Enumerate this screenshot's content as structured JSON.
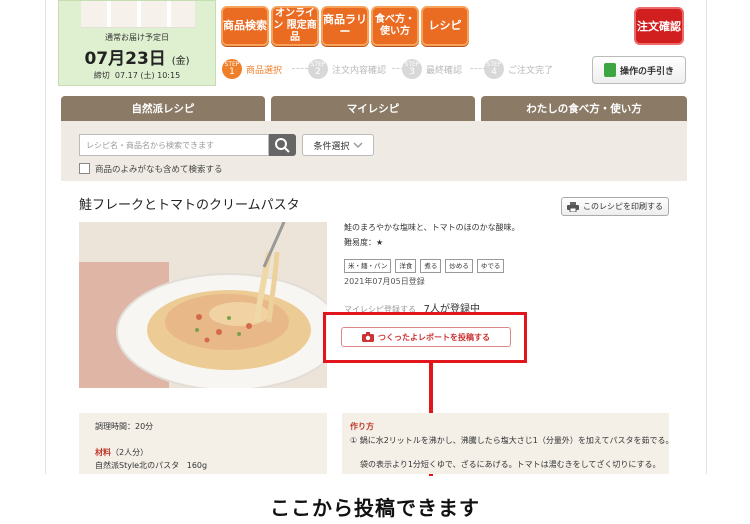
{
  "delivery": {
    "label": "通常お届け予定日",
    "date": "07月23日",
    "weekday": "(金)",
    "deadline_label": "締切",
    "deadline": "07.17 (土) 10:15"
  },
  "nav": {
    "buttons": [
      "商品検索",
      "オンライン 限定商品",
      "商品ラリー",
      "食べ方・ 使い方",
      "レシピ"
    ],
    "order_button": "注文確認"
  },
  "steps": [
    {
      "tag": "STEP",
      "num": "1",
      "label": "商品選択",
      "active": true
    },
    {
      "tag": "STEP",
      "num": "2",
      "label": "注文内容確認",
      "active": false
    },
    {
      "tag": "STEP",
      "num": "3",
      "label": "最終確認",
      "active": false
    },
    {
      "tag": "STEP",
      "num": "4",
      "label": "ご注文完了",
      "active": false
    }
  ],
  "guide_button": "操作の手引き",
  "tabs": [
    "自然派レシピ",
    "マイレシピ",
    "わたしの食べ方・使い方"
  ],
  "search": {
    "placeholder": "レシピ名・商品名から検索できます",
    "condition_button": "条件選択",
    "checkbox_label": "商品のよみがなも含めて検索する"
  },
  "recipe": {
    "title": "鮭フレークとトマトのクリームパスタ",
    "print_button": "このレシピを印刷する",
    "description": "鮭のまろやかな塩味と、トマトのほのかな酸味。",
    "difficulty": "難易度：★",
    "tags": [
      "米・麺・パン",
      "洋食",
      "煮る",
      "炒める",
      "ゆでる"
    ],
    "registered": "2021年07月05日登録",
    "mylist_text": "マイレシピ登録する",
    "mylist_count": "7人が登録中",
    "report_button": "つくったよレポートを投稿する"
  },
  "info": {
    "time": "調理時間：20分",
    "ingredients_heading": "材料",
    "servings": "（2人分）",
    "ingredient_1": "自然派Style北のパスタ",
    "ingredient_1_qty": "160g",
    "method_heading": "作り方",
    "step_1": "① 鍋に水2リットルを沸かし、沸騰したら塩大さじ1（分量外）を加えてパスタを茹でる。",
    "step_2": "袋の表示より1分短くゆで、ざるにあげる。トマトは湯むきをしてざく切りにする。"
  },
  "caption": "ここから投稿できます",
  "colors": {
    "orange": "#ea6c22",
    "red": "#e0161c",
    "tab_brown": "#8a7a66",
    "delivery_green": "#dff0d0"
  }
}
